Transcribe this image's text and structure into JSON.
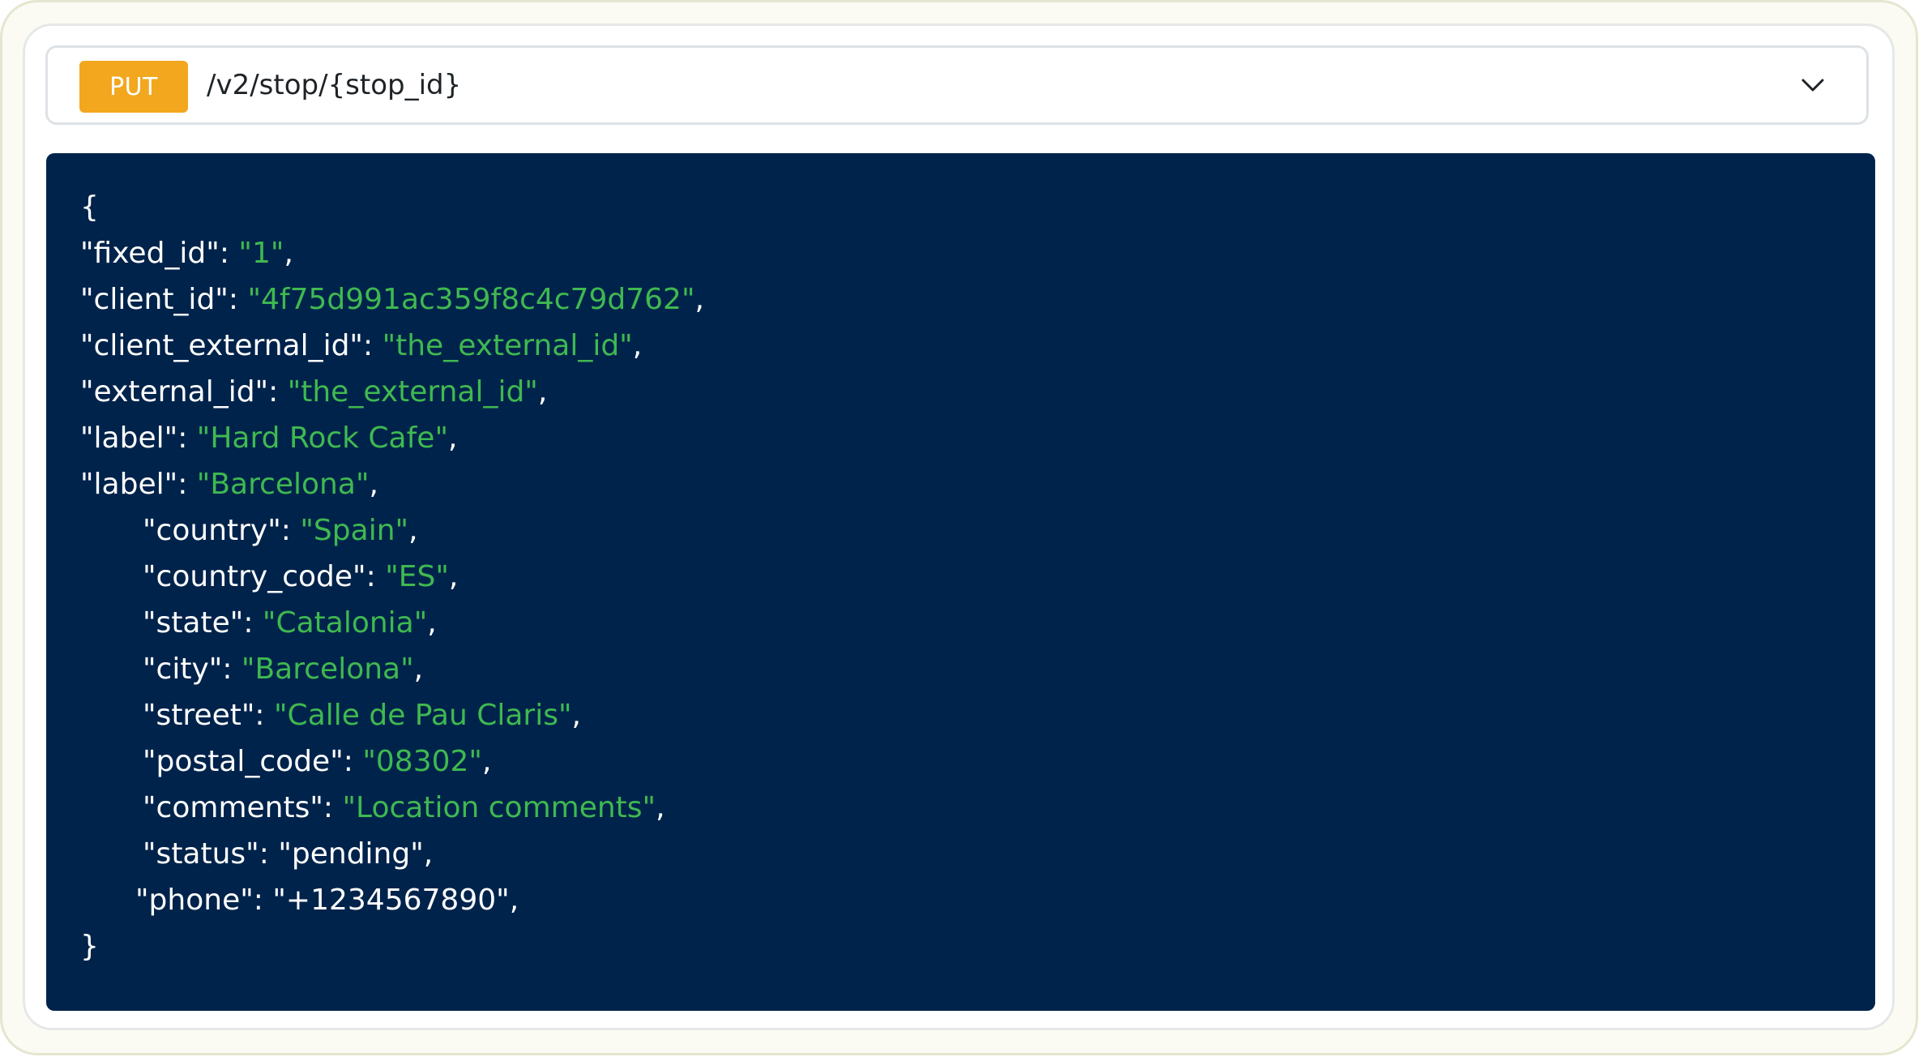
{
  "endpoint": {
    "method": "PUT",
    "path": "/v2/stop/{stop_id}",
    "method_color": "#f2a71e"
  },
  "code": {
    "background": "#00234b",
    "string_color": "#3fb950",
    "open_brace": "{",
    "close_brace": "}",
    "lines": [
      {
        "key": "\"fixed_id\"",
        "value": "\"1\"",
        "value_is_string": true
      },
      {
        "key": "\"client_id\"",
        "value": "\"4f75d991ac359f8c4c79d762\"",
        "value_is_string": true
      },
      {
        "key": "\"client_external_id\"",
        "value": "\"the_external_id\"",
        "value_is_string": true
      },
      {
        "key": "\"external_id\"",
        "value": "\"the_external_id\"",
        "value_is_string": true
      },
      {
        "key": "\"label\"",
        "value": "\"Hard Rock Cafe\"",
        "value_is_string": true
      },
      {
        "key": "\"label\"",
        "value": "\"Barcelona\"",
        "value_is_string": true
      },
      {
        "key": "\"country\"",
        "value": "\"Spain\"",
        "value_is_string": true
      },
      {
        "key": "\"country_code\"",
        "value": "\"ES\"",
        "value_is_string": true
      },
      {
        "key": "\"state\"",
        "value": "\"Catalonia\"",
        "value_is_string": true
      },
      {
        "key": "\"city\"",
        "value": "\"Barcelona\"",
        "value_is_string": true
      },
      {
        "key": "\"street\"",
        "value": "\"Calle de Pau Claris\"",
        "value_is_string": true
      },
      {
        "key": "\"postal_code\"",
        "value": "\"08302\"",
        "value_is_string": true
      },
      {
        "key": "\"comments\"",
        "value": "\"Location comments\"",
        "value_is_string": true
      },
      {
        "key": "\"status\"",
        "value": "\"pending\"",
        "value_is_string": false
      },
      {
        "key": "\"phone\"",
        "value": "\"+1234567890\"",
        "value_is_string": false
      }
    ]
  },
  "icons": {
    "expand": "chevron-down-icon"
  }
}
